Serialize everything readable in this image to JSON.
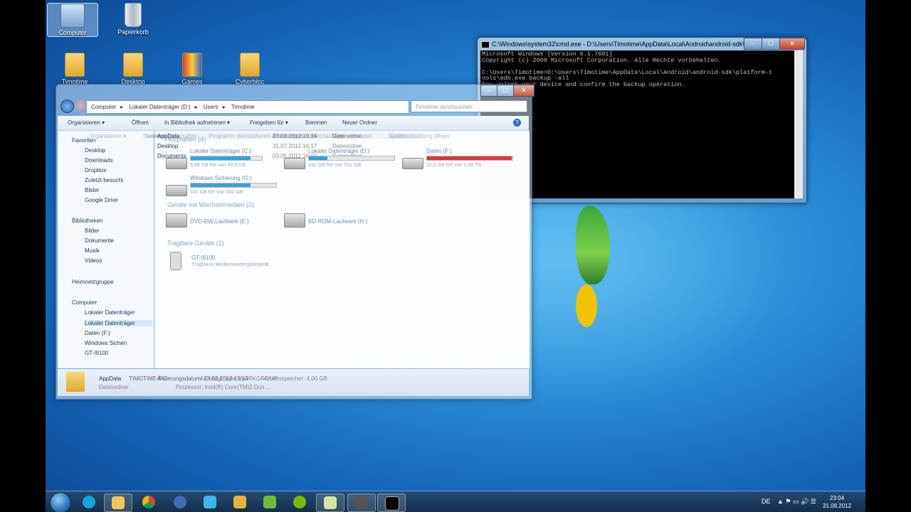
{
  "desktop": {
    "icons": [
      {
        "label": "Computer",
        "icon": "computer-icon"
      },
      {
        "label": "Papierkorb",
        "icon": "recycle-bin-icon"
      },
      {
        "label": "Timotime",
        "icon": "folder-icon"
      },
      {
        "label": "Desktop",
        "icon": "folder-icon"
      },
      {
        "label": "Games",
        "icon": "folder-icon"
      },
      {
        "label": "Cyberbloc",
        "icon": "folder-icon"
      }
    ]
  },
  "cmd": {
    "title": "C:\\Windows\\system32\\cmd.exe - D:\\Users\\Timotime\\AppData\\Local\\Android\\android-sdk\\platfor...",
    "lines": [
      "Microsoft Windows [Version 6.1.7601]",
      "Copyright (c) 2009 Microsoft Corporation. Alle Rechte vorbehalten.",
      "",
      "C:\\Users\\Timotime>D:\\Users\\Timotime\\AppData\\Local\\Android\\android-sdk\\platform-t",
      "ools\\adb.exe backup -all",
      "Now unlock your device and confirm the backup operation."
    ]
  },
  "explorer": {
    "breadcrumb": [
      "Computer",
      "Lokaler Datenträger (D:)",
      "Users",
      "Timotime"
    ],
    "search_placeholder": "Timotime durchsuchen",
    "toolbar": [
      "Organisieren ▾",
      "Öffnen",
      "In Bibliothek aufnehmen ▾",
      "Freigeben für ▾",
      "Brennen",
      "Neuer Ordner"
    ],
    "nav": [
      "Favoriten",
      "Desktop",
      "Downloads",
      "Dropbox",
      "Zuletzt besucht",
      "Bilder",
      "Google Drive",
      "Bibliotheken",
      "Bilder",
      "Dokumente",
      "Musik",
      "Videos",
      "Heimnetzgruppe",
      "Computer",
      "Lokaler Datenträger",
      "Lokaler Datenträger",
      "Daten (F:)",
      "Windows Sichen",
      "GT-I9100"
    ],
    "files": [
      {
        "name": "AppData",
        "date": "27.02.2012 19:14",
        "type": "Dateiordner"
      },
      {
        "name": "Desktop",
        "date": "31.07.2012 16:17",
        "type": "Dateiordner"
      },
      {
        "name": "Documents",
        "date": "03.05.2012 16:10",
        "type": "Dateiordner"
      }
    ],
    "ghost_toolbar": [
      "Organisieren ▾",
      "Systemeigenschaften",
      "Programm deinstallieren oder ändern",
      "Netzlaufwerk verbinden",
      "Systemsteuerung öffnen"
    ],
    "ghost_header": [
      "Name",
      "Änderungsdatum",
      "Typ",
      "Größe"
    ],
    "groups": {
      "drives": "Festplatten (4)",
      "removable": "Geräte mit Wechselmedien (2)",
      "portable": "Tragbare Geräte (1)"
    },
    "drives": [
      {
        "name": "Lokaler Datenträger (C:)",
        "free": "6,96 GB frei von 43,9 GB",
        "fill": 0.84
      },
      {
        "name": "Lokaler Datenträger (D:)",
        "free": "431 GB frei von 552 GB",
        "fill": 0.22
      },
      {
        "name": "Daten (F:)",
        "free": "12,5 GB frei von 1,49 TB",
        "fill": 0.99
      },
      {
        "name": "Windows Sicherung (G:)",
        "free": "101 GB frei von 332 GB",
        "fill": 0.7
      }
    ],
    "removable": [
      "DVD-RW-Laufwerk (E:)",
      "BD-ROM-Laufwerk (H:)"
    ],
    "portable": {
      "name": "GT-I9100",
      "type": "Tragbares Medienwiedergabegerät"
    },
    "details": {
      "name": "AppData",
      "date_label": "Änderungsdatum: 27.02.2012 19:14",
      "kind": "Dateiordner",
      "pc": "TIMOTIME-PC",
      "workgroup": "Arbeitsgruppe: WORKGROUP",
      "ram": "Arbeitsspeicher: 4,00 GB",
      "cpu": "Prozessor: Intel(R) Core(TM)2 Duo ..."
    }
  },
  "taskbar": {
    "lang": "DE",
    "time": "23:04",
    "date": "31.08.2012"
  },
  "colors": {
    "accent": "#1e63b0",
    "drive_bar": "#33a4dc",
    "drive_bar_full": "#d9363e"
  }
}
